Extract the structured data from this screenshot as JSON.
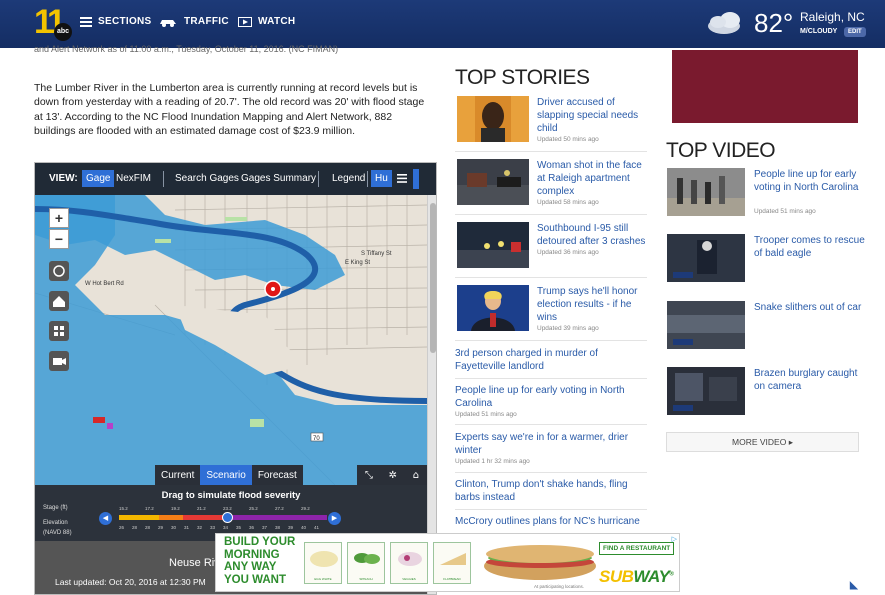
{
  "header": {
    "logo_number": "11",
    "logo_network": "abc",
    "nav": [
      {
        "label": "SECTIONS",
        "icon": "hamburger-icon"
      },
      {
        "label": "TRAFFIC",
        "icon": "car-icon"
      },
      {
        "label": "WATCH",
        "icon": "play-icon"
      }
    ],
    "weather": {
      "temp": "82°",
      "location": "Raleigh, NC",
      "condition": "M/CLOUDY",
      "edit": "EDIT",
      "icon": "cloud-icon"
    }
  },
  "article": {
    "clipped_line": "and Alert Network as of 11:00 a.m., Tuesday, October 11, 2016. (NC FIMAN)",
    "paragraph": "The Lumber River in the Lumberton area is currently running at record levels but is down from yesterday with a reading of 20.7'. The old record was 20' with flood stage at 13'. According to the NC Flood Inundation Mapping and Alert Network, 882 buildings are flooded with an estimated damage cost of $23.9 million."
  },
  "map": {
    "toolbar": {
      "view_label": "VIEW:",
      "items": [
        "Gage",
        "NexFIM",
        "Search Gages",
        "Gages Summary",
        "Legend",
        "Hu"
      ],
      "menu_icon": "hamburger-icon"
    },
    "labels": {
      "street_1": "E King St",
      "street_2": "S Tiffany St",
      "street_3": "W Hot Bert Rd",
      "route": "70"
    },
    "tabs": [
      "Current",
      "Scenario",
      "Forecast"
    ],
    "active_tab": "Scenario",
    "slider": {
      "title": "Drag to simulate flood severity",
      "stage_label": "Stage (ft)",
      "elevation_label": "Elevation (NAVD 88)",
      "stage_ticks": [
        "15.2",
        "17.2",
        "19.2",
        "21.2",
        "23.2",
        "25.2",
        "27.2",
        "29.2"
      ],
      "elevation_ticks": [
        "26",
        "28",
        "28",
        "29",
        "30",
        "31",
        "32",
        "33",
        "34",
        "35",
        "36",
        "37",
        "38",
        "39",
        "40",
        "41"
      ],
      "level": 0.52
    },
    "gage_name": "Neuse Riv",
    "last_updated": "Last updated: Oct 20, 2016 at 12:30 PM"
  },
  "top_stories": {
    "heading": "TOP STORIES",
    "with_thumbs": [
      {
        "title": "Driver accused of slapping special needs child",
        "updated": "Updated 50 mins ago"
      },
      {
        "title": "Woman shot in the face at Raleigh apartment complex",
        "updated": "Updated 58 mins ago"
      },
      {
        "title": "Southbound I-95 still detoured after 3 crashes",
        "updated": "Updated 36 mins ago"
      },
      {
        "title": "Trump says he'll honor election results - if he wins",
        "updated": "Updated 39 mins ago"
      }
    ],
    "text_only": [
      {
        "title": "3rd person charged in murder of Fayetteville landlord",
        "updated": ""
      },
      {
        "title": "People line up for early voting in North Carolina",
        "updated": "Updated 51 mins ago"
      },
      {
        "title": "Experts say we're in for a warmer, drier winter",
        "updated": "Updated 1 hr 32 mins ago"
      },
      {
        "title": "Clinton, Trump don't shake hands, fling barbs instead",
        "updated": ""
      },
      {
        "title": "McCrory outlines plans for NC's hurricane",
        "updated": ""
      }
    ]
  },
  "top_video": {
    "heading": "TOP VIDEO",
    "items": [
      {
        "title": "People line up for early voting in North Carolina",
        "updated": "Updated 51 mins ago"
      },
      {
        "title": "Trooper comes to rescue of bald eagle",
        "updated": ""
      },
      {
        "title": "Snake slithers out of car",
        "updated": ""
      },
      {
        "title": "Brazen burglary caught on camera",
        "updated": ""
      }
    ],
    "more": "MORE VIDEO ▸"
  },
  "ad": {
    "headline": [
      "BUILD YOUR",
      "MORNING",
      "ANY WAY",
      "YOU WANT"
    ],
    "cards": [
      "EGG WHITE",
      "SPINACH",
      "VEGGIES",
      "FLATBREAD"
    ],
    "find": "FIND A RESTAURANT",
    "brand_1": "SUB",
    "brand_2": "WAY",
    "mark": "®",
    "disclaimer": "At participating locations.",
    "choices_icon": "ad-choices-icon"
  },
  "colors": {
    "header": "#1d3a78",
    "link": "#2a5ba8",
    "accent": "#2f6fd6",
    "water": "#3c9bd6",
    "ad_green": "#2d8c2d",
    "ad_yellow": "#f3c000"
  }
}
